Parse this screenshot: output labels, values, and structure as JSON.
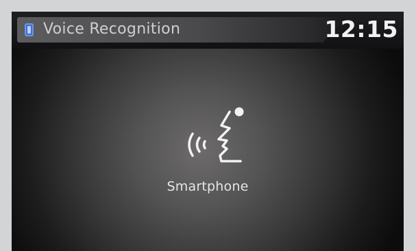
{
  "header": {
    "title": "Voice Recognition",
    "time": "12:15",
    "status_icon": "bluetooth-phone-icon"
  },
  "main": {
    "icon": "voice-recognition-icon",
    "label": "Smartphone"
  },
  "colors": {
    "icon_accent": "#3d6fd1",
    "text": "#e6e6e6"
  }
}
